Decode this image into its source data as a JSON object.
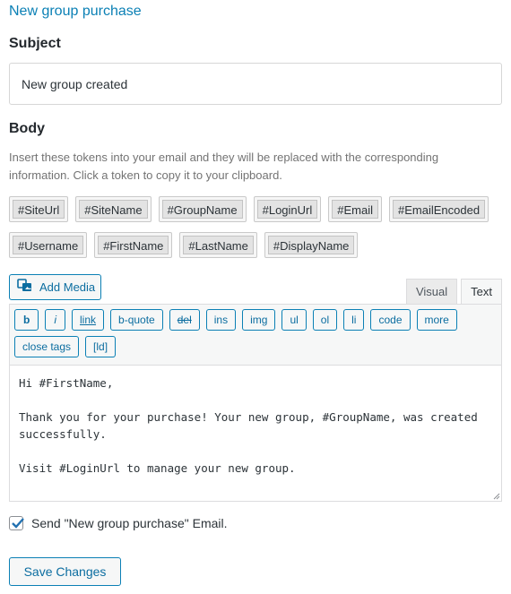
{
  "section_title": "New group purchase",
  "subject": {
    "label": "Subject",
    "value": "New group created"
  },
  "body": {
    "label": "Body",
    "help": "Insert these tokens into your email and they will be replaced with the corresponding information. Click a token to copy it to your clipboard."
  },
  "tokens": {
    "row1": [
      "#SiteUrl",
      "#SiteName",
      "#GroupName",
      "#LoginUrl",
      "#Email",
      "#EmailEncoded"
    ],
    "row2": [
      "#Username",
      "#FirstName",
      "#LastName",
      "#DisplayName"
    ]
  },
  "editor": {
    "add_media": "Add Media",
    "tabs": {
      "visual": "Visual",
      "text": "Text"
    },
    "quicktags": {
      "b": "b",
      "i": "i",
      "link": "link",
      "bquote": "b-quote",
      "del": "del",
      "ins": "ins",
      "img": "img",
      "ul": "ul",
      "ol": "ol",
      "li": "li",
      "code": "code",
      "more": "more",
      "close_tags": "close tags",
      "ld": "[ld]"
    },
    "content": "Hi #FirstName,\n\nThank you for your purchase! Your new group, #GroupName, was created successfully.\n\nVisit #LoginUrl to manage your new group."
  },
  "send_email": {
    "label": "Send \"New group purchase\" Email.",
    "checked": true
  },
  "save_button": "Save Changes",
  "colors": {
    "accent": "#0b80b5",
    "text": "#1d2327"
  }
}
